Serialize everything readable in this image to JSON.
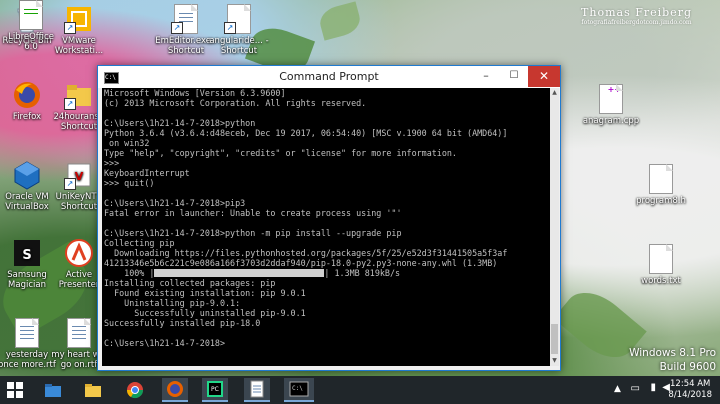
{
  "watermark": {
    "name": "Thomas Freiberg",
    "sub": "fotografiafreibergdotcom.jimdo.com"
  },
  "desktop_icons": [
    {
      "label": "Recycle Bin"
    },
    {
      "label": "VMware Workstati..."
    },
    {
      "label": "LibreOffice 6.0"
    },
    {
      "label": "EmEditor.exe - Shortcut"
    },
    {
      "label": "angularide... - Shortcut"
    },
    {
      "label": "Firefox"
    },
    {
      "label": "24hourans - Shortcut"
    },
    {
      "label": "Oracle VM VirtualBox"
    },
    {
      "label": "UniKeyNT - Shortcut"
    },
    {
      "label": "Samsung Magician"
    },
    {
      "label": "Active Presenter"
    },
    {
      "label": "yesterday once more.rtf"
    },
    {
      "label": "my heart will go on.rtf"
    },
    {
      "label": "anagram.cpp"
    },
    {
      "label": "program8.h"
    },
    {
      "label": "words.txt"
    }
  ],
  "cmd": {
    "title": "Command Prompt",
    "lines": [
      "Microsoft Windows [Version 6.3.9600]",
      "(c) 2013 Microsoft Corporation. All rights reserved.",
      "",
      "C:\\Users\\1h21-14-7-2018>python",
      "Python 3.6.4 (v3.6.4:d48eceb, Dec 19 2017, 06:54:40) [MSC v.1900 64 bit (AMD64)]",
      " on win32",
      "Type \"help\", \"copyright\", \"credits\" or \"license\" for more information.",
      ">>>",
      "KeyboardInterrupt",
      ">>> quit()",
      "",
      "C:\\Users\\1h21-14-7-2018>pip3",
      "Fatal error in launcher: Unable to create process using '\"'",
      "",
      "C:\\Users\\1h21-14-7-2018>python -m pip install --upgrade pip",
      "Collecting pip",
      "  Downloading https://files.pythonhosted.org/packages/5f/25/e52d3f31441505a5f3af",
      "41213346e5b6c221c9e086a166f3703d2ddaf940/pip-18.0-py2.py3-none-any.whl (1.3MB)",
      "",
      "Installing collected packages: pip",
      "  Found existing installation: pip 9.0.1",
      "    Uninstalling pip-9.0.1:",
      "      Successfully uninstalled pip-9.0.1",
      "Successfully installed pip-18.0",
      "",
      "C:\\Users\\1h21-14-7-2018>"
    ],
    "progress": {
      "percent_label": "    100% |",
      "end_label": "| 1.3MB 819kB/s",
      "value": 1.0
    }
  },
  "os": {
    "edition": "Windows 8.1 Pro",
    "build": "Build 9600"
  },
  "taskbar": {
    "apps": [
      "start-icon",
      "explorer-icon",
      "folder-icon",
      "chrome-icon",
      "firefox-icon",
      "pycharm-icon",
      "notepad-icon",
      "cmd-icon"
    ],
    "time": "12:54 AM",
    "date": "8/14/2018"
  }
}
